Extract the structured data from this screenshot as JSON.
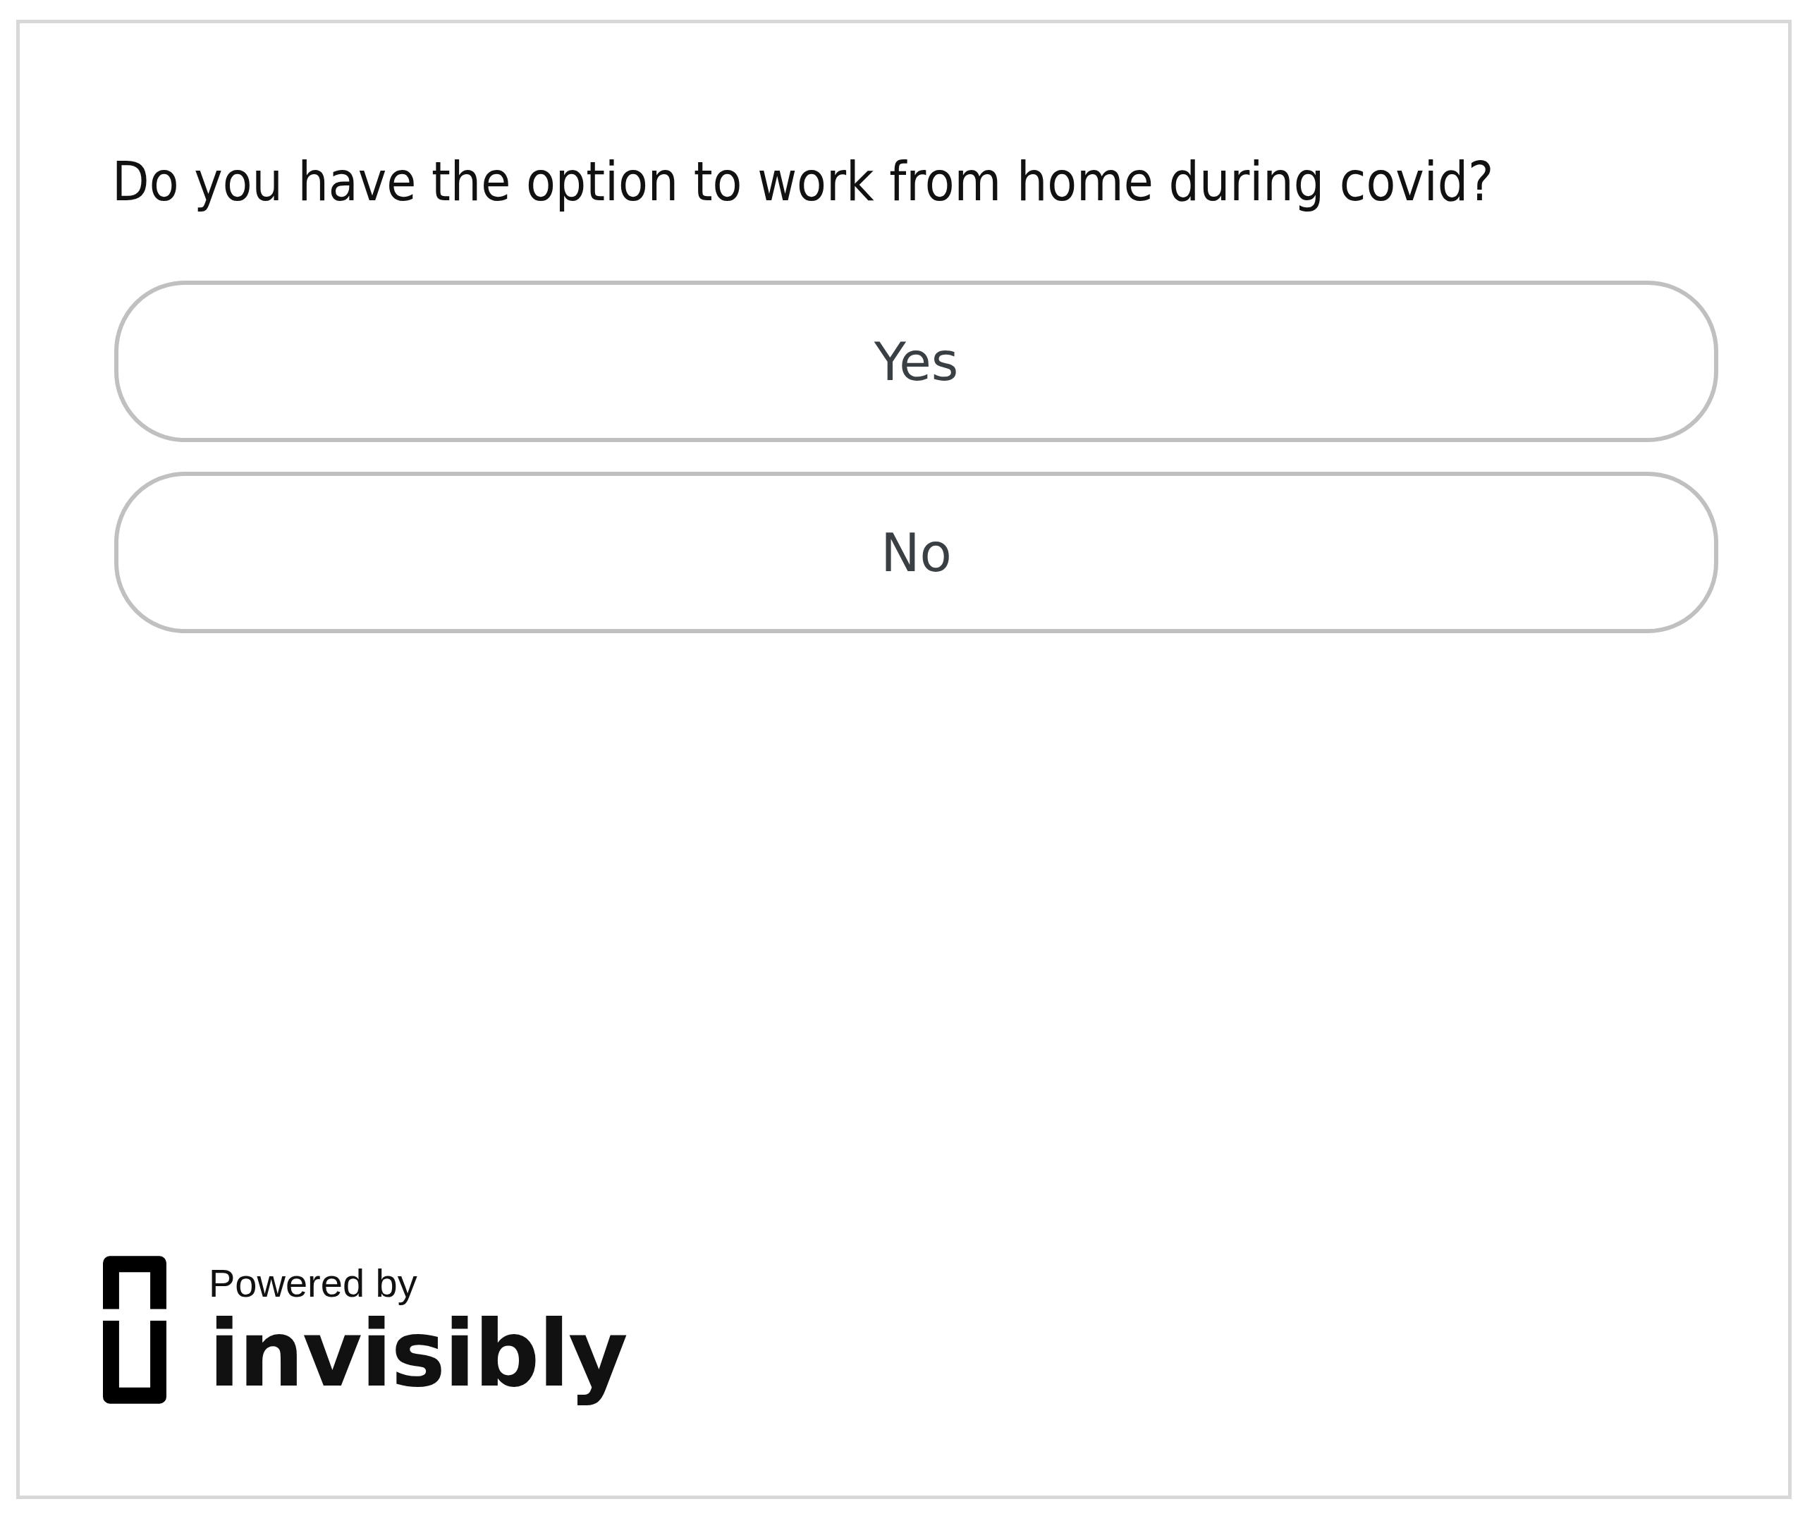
{
  "question": "Do you have the option to work from home during covid?",
  "options": [
    {
      "label": "Yes",
      "selected": false
    },
    {
      "label": "No",
      "selected": false
    }
  ],
  "footer": {
    "powered_by": "Powered by",
    "brand": "invisibly"
  }
}
